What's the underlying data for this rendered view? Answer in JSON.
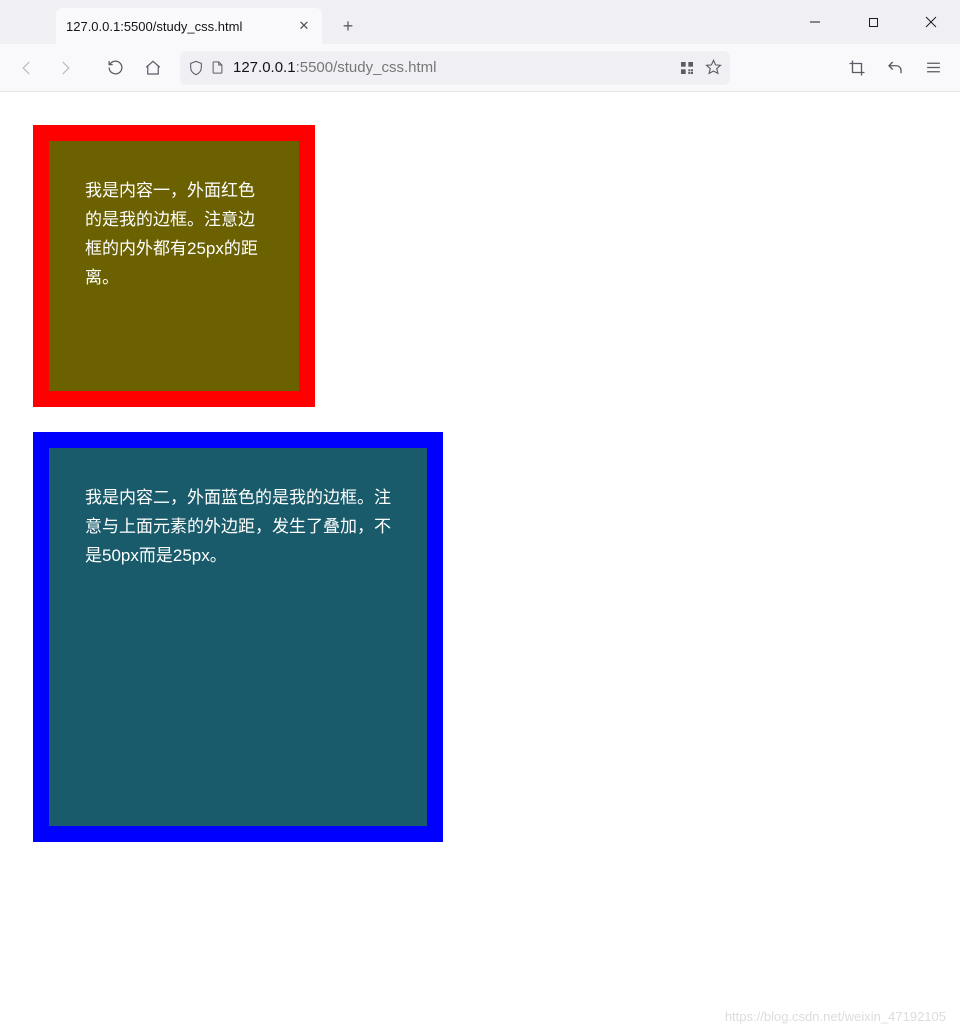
{
  "titlebar": {
    "tab_title": "127.0.0.1:5500/study_css.html",
    "tab_close": "✕",
    "new_tab": "+"
  },
  "toolbar": {
    "url_prefix": "127.0.0.1",
    "url_suffix": ":5500/study_css.html"
  },
  "page": {
    "box1_text": "我是内容一，外面红色的是我的边框。注意边框的内外都有25px的距离。",
    "box2_text": "我是内容二，外面蓝色的是我的边框。注意与上面元素的外边距，发生了叠加，不是50px而是25px。"
  },
  "watermark": "https://blog.csdn.net/weixin_47192105"
}
